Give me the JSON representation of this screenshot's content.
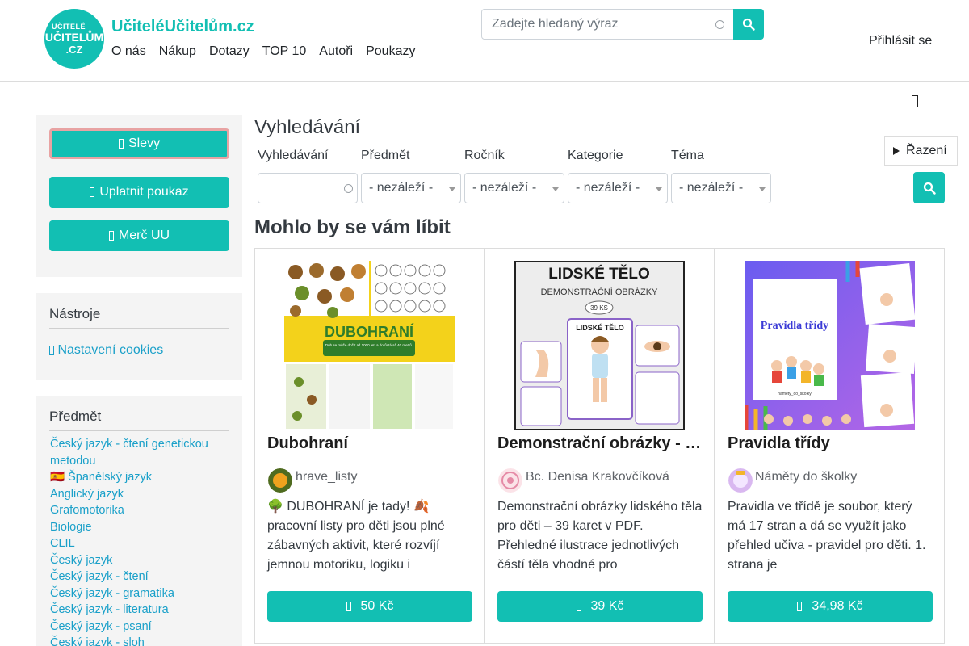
{
  "header": {
    "logo": {
      "line1": "UČITELÉ",
      "line2": "UČITELŮM",
      "line3": ".CZ"
    },
    "site_title": "UčiteléUčitelům.cz",
    "nav": [
      "O nás",
      "Nákup",
      "Dotazy",
      "TOP 10",
      "Autoři",
      "Poukazy"
    ],
    "search": {
      "placeholder": "Zadejte hledaný výraz",
      "value": ""
    },
    "login": "Přihlásit se"
  },
  "sidebar": {
    "buttons": {
      "discounts": "Slevy",
      "apply_voucher": "Uplatnit poukaz",
      "merch": "Merč UU"
    },
    "tools": {
      "title": "Nástroje",
      "cookies": "Nastavení cookies"
    },
    "subjects": {
      "title": "Předmět",
      "items": [
        "Český jazyk - čtení genetickou metodou",
        "🇪🇸 Španělský jazyk",
        "Anglický jazyk",
        "Grafomotorika",
        "Biologie",
        "CLIL",
        "Český jazyk",
        "Český jazyk - čtení",
        "Český jazyk - gramatika",
        "Český jazyk - literatura",
        "Český jazyk - psaní",
        "Český jazyk - sloh"
      ]
    }
  },
  "main": {
    "title": "Vyhledávání",
    "sort_label": "Řazení",
    "filters": {
      "search_label": "Vyhledávání",
      "subject_label": "Předmět",
      "grade_label": "Ročník",
      "category_label": "Kategorie",
      "topic_label": "Téma",
      "subject_value": "- nezáleží -",
      "grade_value": "- nezáleží -",
      "category_value": "- nezáleží -",
      "topic_value": "- nezáleží -"
    },
    "section_title": "Mohlo by se vám líbit",
    "products": [
      {
        "title": "Dubohraní",
        "author": "hrave_listy",
        "description": "🌳 DUBOHRANÍ je tady! 🍂 pracovní listy pro děti jsou plné zábavných aktivit, které rozvíjí jemnou motoriku, logiku i",
        "price": "50 Kč",
        "image_text": {
          "banner": "DUBOHRANÍ",
          "sub": "Dub se může dožít až 1000 let, a dorůstá až 40 metrů."
        }
      },
      {
        "title": "Demonstrační obrázky - lidské tělo",
        "author": "Bc. Denisa Krakovčíková",
        "description": "Demonstrační obrázky lidského těla pro děti – 39 karet v PDF. Přehledné ilustrace jednotlivých částí těla vhodné pro",
        "price": "39 Kč",
        "image_text": {
          "heading": "LIDSKÉ TĚLO",
          "sub": "DEMONSTRAČNÍ OBRÁZKY",
          "count": "39 KS",
          "card": "LIDSKÉ TĚLO"
        }
      },
      {
        "title": "Pravidla třídy",
        "author": "Náměty do školky",
        "description": "Pravidla ve třídě je soubor, který má 17 stran a dá se využít jako přehled učiva - pravidel pro děti. 1. strana je",
        "price": "34,98 Kč",
        "image_text": {
          "heading": "Pravidla třídy",
          "handle": "namety_do_skolky"
        }
      }
    ]
  },
  "colors": {
    "accent": "#12bfb3",
    "link": "#1aa0c9",
    "sidebar_bg": "#f4f4f4",
    "slevy_border": "#e8a3a3"
  },
  "icons": [
    "search-icon",
    "bookmark-icon",
    "tag-icon",
    "ticket-icon",
    "shirt-icon",
    "cookie-icon",
    "cart-icon"
  ]
}
